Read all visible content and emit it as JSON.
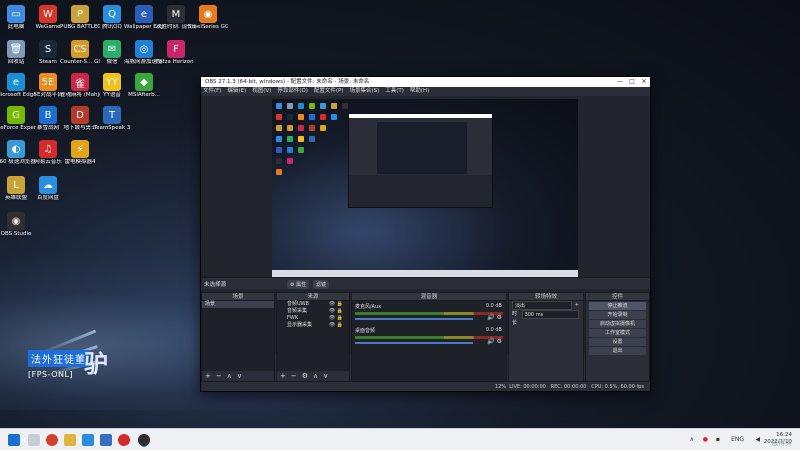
{
  "desktop": {
    "icons": [
      {
        "label": "此电脑",
        "color": "#3d8be0",
        "glyph": "▭"
      },
      {
        "label": "WeGame",
        "color": "#d7352a",
        "glyph": "W"
      },
      {
        "label": "PUBG BATTLEGR...",
        "color": "#c9a33a",
        "glyph": "P"
      },
      {
        "label": "腾讯QQ",
        "color": "#2a8ee0",
        "glyph": "Q"
      },
      {
        "label": "Wallpaper Engine: ...",
        "color": "#2c5bb8",
        "glyph": "e"
      },
      {
        "label": "决胜时刻: 现代战争",
        "color": "#2b2e36",
        "glyph": "M"
      },
      {
        "label": "SteelSeries GG",
        "color": "#e37a1e",
        "glyph": "◉"
      },
      {
        "label": "回收站",
        "color": "#7f9ab5",
        "glyph": "🗑"
      },
      {
        "label": "Steam",
        "color": "#1b2838",
        "glyph": "S"
      },
      {
        "label": "Counter-S... Global Off...",
        "color": "#d49b2a",
        "glyph": "CS"
      },
      {
        "label": "微信",
        "color": "#2aae67",
        "glyph": "✉"
      },
      {
        "label": "海豚网游加速器5.2",
        "color": "#1f7fd4",
        "glyph": "◎"
      },
      {
        "label": "Forza Horizon 5",
        "color": "#c6286b",
        "glyph": "F"
      },
      {
        "label": "Microsoft Edge",
        "color": "#1a8fd6",
        "glyph": "e"
      },
      {
        "label": "5E对战平台",
        "color": "#f08a1c",
        "glyph": "5E"
      },
      {
        "label": "雀魂麻将 (Mahjong...",
        "color": "#c9284a",
        "glyph": "雀"
      },
      {
        "label": "YY语音",
        "color": "#f2c21c",
        "glyph": "YY"
      },
      {
        "label": "MSIAfterb...",
        "color": "#3aa83a",
        "glyph": "◆"
      },
      {
        "label": "GeForce Experience",
        "color": "#76b900",
        "glyph": "G"
      },
      {
        "label": "暴雪战网",
        "color": "#1a6fd0",
        "glyph": "B"
      },
      {
        "label": "地下城与勇士",
        "color": "#b43a2a",
        "glyph": "D"
      },
      {
        "label": "TeamSpeak 3",
        "color": "#2a6ab8",
        "glyph": "T"
      },
      {
        "label": "360 极速浏览器X",
        "color": "#3a9ad8",
        "glyph": "◐"
      },
      {
        "label": "网易云音乐",
        "color": "#d42a2a",
        "glyph": "♫"
      },
      {
        "label": "雷电模拟器4",
        "color": "#e0a41c",
        "glyph": "⚡"
      },
      {
        "label": "英雄联盟",
        "color": "#c9a33a",
        "glyph": "L"
      },
      {
        "label": "百度网盘",
        "color": "#2a8ee0",
        "glyph": "☁"
      },
      {
        "label": "OBS Studio",
        "color": "#302e31",
        "glyph": "◉"
      }
    ],
    "caption_cn": "法外狂徒董",
    "caption_en": "[FPS-ONL]",
    "caption_big": "驴"
  },
  "obs": {
    "title": "OBS 27.1.3 (64-bit, windows) - 配置文件: 未命名 - 场景: 未命名",
    "menu": [
      "文件(F)",
      "编辑(E)",
      "视图(V)",
      "停靠部件(D)",
      "配置文件(P)",
      "场景集合(S)",
      "工具(T)",
      "帮助(H)"
    ],
    "no_source": "未选择源",
    "props_btn": "⚙ 属性",
    "filters_btn": "滤镜",
    "docks": {
      "scenes": {
        "title": "场景",
        "items": [
          "场景"
        ]
      },
      "sources": {
        "title": "来源",
        "items": [
          "音频UWB",
          "音频采集",
          "FWK",
          "显示器采集"
        ]
      },
      "mixer": {
        "title": "混音器",
        "channels": [
          {
            "name": "麦克风/Aux",
            "db": "0.0 dB"
          },
          {
            "name": "桌面音频",
            "db": "0.0 dB"
          }
        ]
      },
      "transitions": {
        "title": "转场特效",
        "type": "淡出",
        "duration_label": "时长",
        "duration": "300 ms"
      },
      "controls": {
        "title": "控件",
        "buttons": [
          "停止推流",
          "开始录制",
          "启动虚拟摄像机",
          "工作室模式",
          "设置",
          "退出"
        ]
      }
    },
    "status": {
      "live": "LIVE: 00:00:00",
      "rec": "REC: 00:00:00",
      "cpu": "CPU: 0.5%, 60.00 fps",
      "dropped": "12%"
    }
  },
  "taskbar": {
    "lang": "ENG",
    "time": "16:24",
    "date": "2022/1/10",
    "watermark": "值得买"
  }
}
